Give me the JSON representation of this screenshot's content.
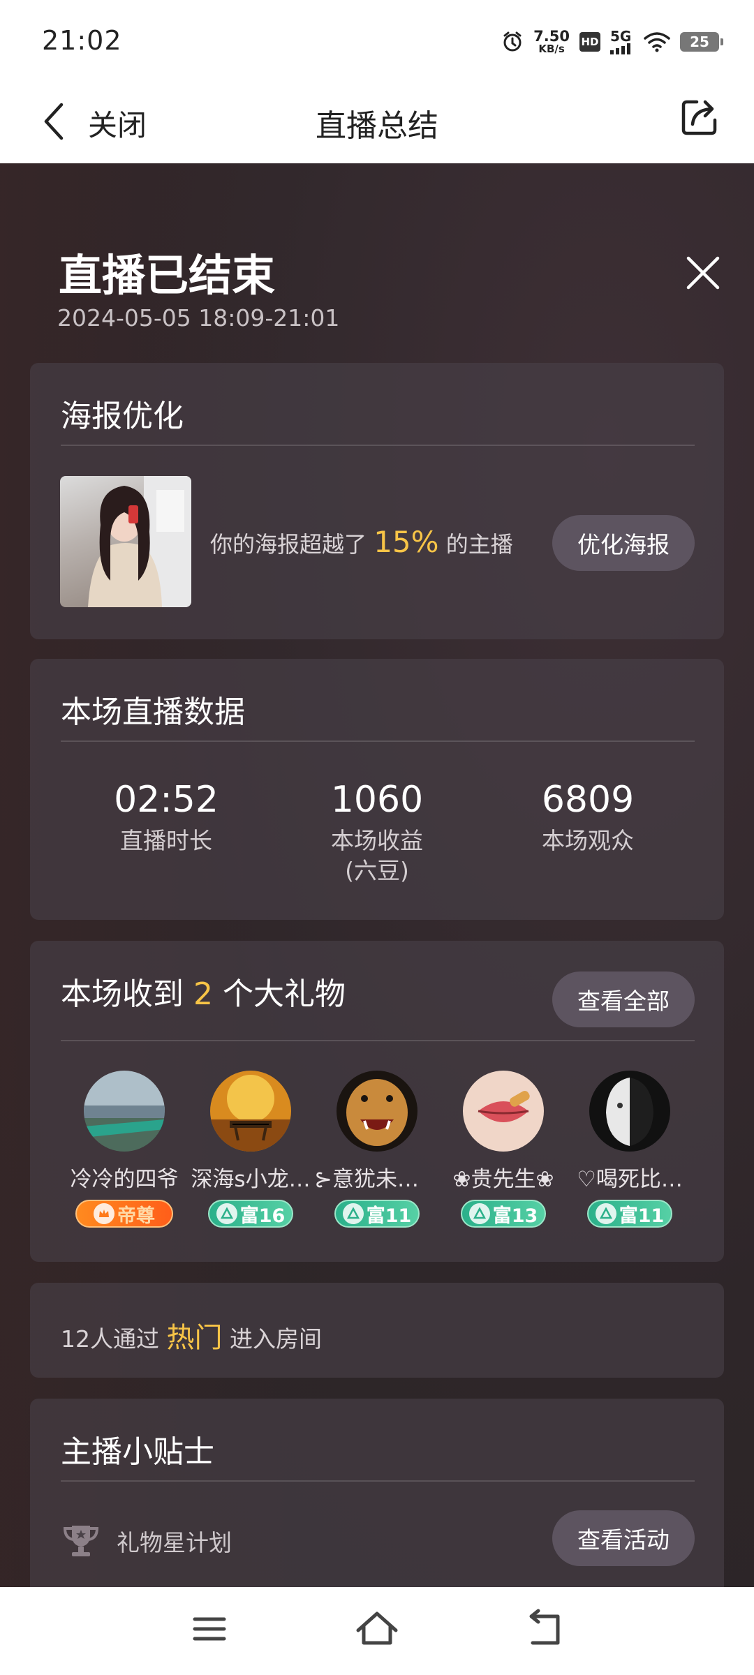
{
  "status_bar": {
    "time": "21:02",
    "net_speed_value": "7.50",
    "net_speed_unit": "KB/s",
    "hd_label": "HD",
    "network_label": "5G",
    "battery_level": "25",
    "icons": [
      "alarm-icon",
      "hd-icon",
      "signal-icon",
      "wifi-icon",
      "battery-icon"
    ]
  },
  "nav": {
    "close_label": "关闭",
    "title": "直播总结"
  },
  "header": {
    "title": "直播已结束",
    "date_range": "2024-05-05 18:09-21:01"
  },
  "poster": {
    "title": "海报优化",
    "desc_prefix": "你的海报超越了",
    "percent": "15%",
    "desc_suffix": "的主播",
    "button_label": "优化海报"
  },
  "stats": {
    "title": "本场直播数据",
    "items": [
      {
        "value": "02:52",
        "label": "直播时长"
      },
      {
        "value": "1060",
        "label": "本场收益\n(六豆)"
      },
      {
        "value": "6809",
        "label": "本场观众"
      }
    ]
  },
  "gifts": {
    "title_prefix": "本场收到",
    "count": "2",
    "title_suffix": "个大礼物",
    "view_all_label": "查看全部",
    "gifters": [
      {
        "name": "冷冷的四爷",
        "badge": "帝尊",
        "badge_type": "emperor"
      },
      {
        "name": "深海s小龙…",
        "badge": "富16",
        "badge_type": "rich"
      },
      {
        "name": "⊱意犹未尽…",
        "badge": "富11",
        "badge_type": "rich"
      },
      {
        "name": "❀贵先生❀",
        "badge": "富13",
        "badge_type": "rich"
      },
      {
        "name": "♡喝死比…",
        "badge": "富11",
        "badge_type": "rich"
      }
    ]
  },
  "hot": {
    "prefix": "12人通过",
    "highlight": "热门",
    "suffix": "进入房间"
  },
  "tips": {
    "title": "主播小贴士",
    "item_label": "礼物星计划",
    "button_label": "查看活动"
  },
  "colors": {
    "highlight": "#f7c447",
    "card_bg": "#484048",
    "button_bg": "#5d5460"
  }
}
